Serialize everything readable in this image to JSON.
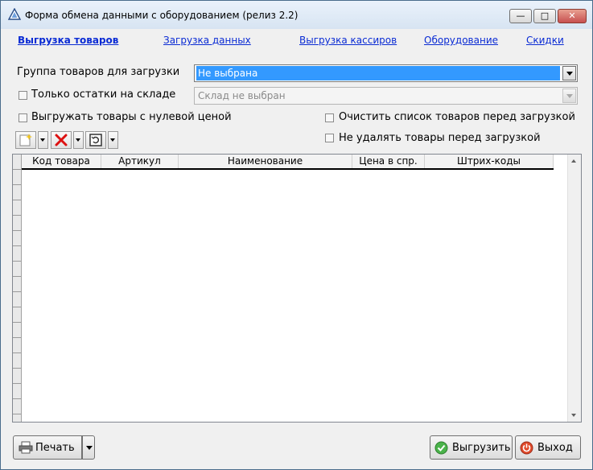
{
  "window": {
    "title": "Форма обмена данными с оборудованием (релиз 2.2)",
    "minimize_icon": "minimize-icon",
    "maximize_icon": "maximize-icon",
    "close_icon": "close-icon"
  },
  "tabs": [
    {
      "label": "Выгрузка товаров",
      "active": true
    },
    {
      "label": "Загрузка данных",
      "active": false
    },
    {
      "label": "Выгрузка кассиров",
      "active": false
    },
    {
      "label": "Оборудование",
      "active": false
    },
    {
      "label": "Скидки",
      "active": false
    }
  ],
  "form": {
    "group_label": "Группа товаров для загрузки",
    "group_value": "Не выбрана",
    "stock_only_label": "Только остатки на складе",
    "warehouse_value": "Склад не выбран",
    "zero_price_label": "Выгружать товары с нулевой ценой",
    "clear_list_label": "Очистить список товаров перед загрузкой",
    "no_delete_label": "Не удалять товары перед загрузкой"
  },
  "toolbar": {
    "add_icon": "add-icon",
    "delete_icon": "delete-icon",
    "refresh_icon": "refresh-icon"
  },
  "table": {
    "columns": [
      "Код товара",
      "Артикул",
      "Наименование",
      "Цена в спр.",
      "Штрих-коды"
    ],
    "rows": []
  },
  "footer": {
    "print_label": "Печать",
    "upload_label": "Выгрузить",
    "exit_label": "Выход"
  },
  "colors": {
    "link": "#0a2bd4",
    "selection": "#3399ff"
  }
}
